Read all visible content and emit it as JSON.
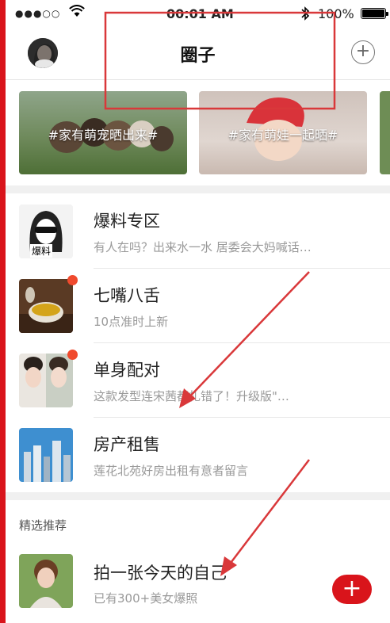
{
  "status": {
    "signal": "●●●○○",
    "wifi_icon": "wifi-icon",
    "time": "00:01 AM",
    "bluetooth_icon": "bluetooth-icon",
    "battery_pct": "100%",
    "battery_level": 1.0
  },
  "nav": {
    "title": "圈子",
    "add_symbol": "+"
  },
  "banners": [
    {
      "label": "#家有萌宠晒出来#"
    },
    {
      "label": "#家有萌娃一起晒#"
    }
  ],
  "groups": [
    {
      "name": "爆料专区",
      "desc": "有人在吗？出来水一水 居委会大妈喊话…",
      "thumb_text": "爆料",
      "unread": false
    },
    {
      "name": "七嘴八舌",
      "desc": "10点准时上新",
      "unread": true
    },
    {
      "name": "单身配对",
      "desc": "这款发型连宋茜都扎错了！升级版\"…",
      "unread": true
    },
    {
      "name": "房产租售",
      "desc": "莲花北苑好房出租有意者留言",
      "unread": false
    }
  ],
  "recommend": {
    "section_label": "精选推荐",
    "items": [
      {
        "name": "拍一张今天的自己",
        "desc": "已有300+美女爆照"
      }
    ]
  },
  "fab": {
    "symbol": "+"
  },
  "colors": {
    "accent_red": "#d9141b",
    "badge_red": "#f04a2d",
    "annotation_red": "#d9383a",
    "separator": "#f0f0f0"
  }
}
